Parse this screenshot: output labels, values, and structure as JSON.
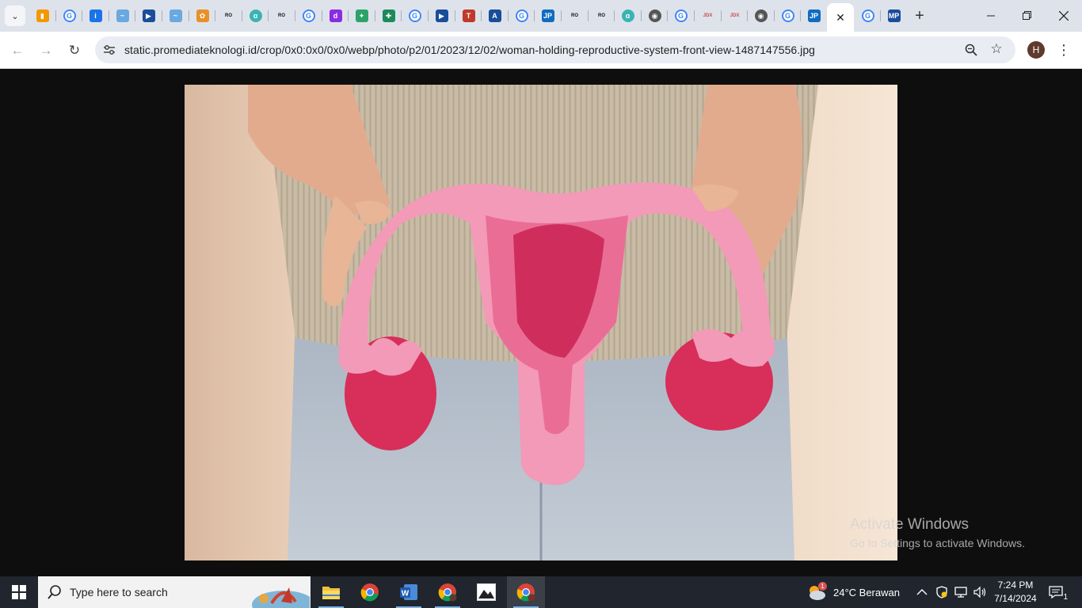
{
  "browser": {
    "tab_search_icon": "chevron-down-icon",
    "tabs": [
      {
        "favicon": "analytics-icon",
        "color": "#f29900"
      },
      {
        "favicon": "google-icon",
        "color": "#4285f4"
      },
      {
        "favicon": "info-icon",
        "color": "#1a73e8"
      },
      {
        "favicon": "bird-icon",
        "color": "#6aa8e0"
      },
      {
        "favicon": "play-icon",
        "color": "#1a4d9a"
      },
      {
        "favicon": "bird-icon",
        "color": "#6aa8e0"
      },
      {
        "favicon": "flower-icon",
        "color": "#e8902a"
      },
      {
        "favicon": "ro-icon",
        "color": "#111111"
      },
      {
        "favicon": "swirl-icon",
        "color": "#3bb3b3"
      },
      {
        "favicon": "ro-icon",
        "color": "#111111"
      },
      {
        "favicon": "google-icon",
        "color": "#4285f4"
      },
      {
        "favicon": "d-icon",
        "color": "#8b2be2"
      },
      {
        "favicon": "sparkle-icon",
        "color": "#2aa36a"
      },
      {
        "favicon": "cross-icon",
        "color": "#1e8a5a"
      },
      {
        "favicon": "google-icon",
        "color": "#4285f4"
      },
      {
        "favicon": "play-icon",
        "color": "#1a4d9a"
      },
      {
        "favicon": "t-icon",
        "color": "#c0392b"
      },
      {
        "favicon": "a-icon",
        "color": "#1a4d9a"
      },
      {
        "favicon": "google-icon",
        "color": "#4285f4"
      },
      {
        "favicon": "jp-icon",
        "color": "#0f6cc0"
      },
      {
        "favicon": "ro-icon",
        "color": "#111111"
      },
      {
        "favicon": "ro-icon",
        "color": "#111111"
      },
      {
        "favicon": "swirl-icon",
        "color": "#3bb3b3"
      },
      {
        "favicon": "chrome-icon",
        "color": "#555555"
      },
      {
        "favicon": "google-icon",
        "color": "#4285f4"
      },
      {
        "favicon": "jdx-icon",
        "color": "#c44d4d"
      },
      {
        "favicon": "jdx-icon",
        "color": "#c44d4d"
      },
      {
        "favicon": "chrome-icon",
        "color": "#555555"
      },
      {
        "favicon": "google-icon",
        "color": "#4285f4"
      },
      {
        "favicon": "jp-icon",
        "color": "#0f6cc0"
      },
      {
        "favicon": "close-icon",
        "color": "#222222",
        "active": true
      },
      {
        "favicon": "google-icon",
        "color": "#4285f4"
      },
      {
        "favicon": "mp-icon",
        "color": "#1a4d9a"
      }
    ],
    "new_tab_label": "+",
    "window_controls": {
      "minimize": "—",
      "restore": "❐",
      "close": "✕"
    },
    "toolbar": {
      "back": "←",
      "forward": "→",
      "reload": "↻",
      "url": "static.promediateknologi.id/crop/0x0:0x0/0x0/webp/photo/p2/01/2023/12/02/woman-holding-reproductive-system-front-view-1487147556.jpg",
      "zoom_icon": "zoom-icon",
      "bookmark_icon": "star-icon",
      "profile_initial": "H",
      "menu_icon": "⋮"
    }
  },
  "watermark": {
    "line1": "Activate Windows",
    "line2": "Go to Settings to activate Windows."
  },
  "taskbar": {
    "search_placeholder": "Type here to search",
    "weather": "24°C  Berawan",
    "weather_badge": "1",
    "time": "7:24 PM",
    "date": "7/14/2024",
    "notifications_count": "1",
    "apps": [
      "file-explorer",
      "chrome",
      "word",
      "chrome-profile",
      "photos",
      "chrome-active"
    ]
  }
}
